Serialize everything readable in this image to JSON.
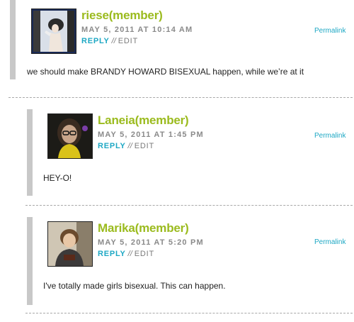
{
  "comments": [
    {
      "author": "riese(member)",
      "date": "MAY 5, 2011 AT 10:14 AM",
      "reply": "REPLY",
      "separator": "//",
      "edit": "EDIT",
      "permalink": "Permalink",
      "text": "we should make BRANDY HOWARD BISEXUAL happen, while we’re at it"
    },
    {
      "author": "Laneia(member)",
      "date": "MAY 5, 2011 AT 1:45 PM",
      "reply": "REPLY",
      "separator": "//",
      "edit": "EDIT",
      "permalink": "Permalink",
      "text": "HEY-O!"
    },
    {
      "author": "Marika(member)",
      "date": "MAY 5, 2011 AT 5:20 PM",
      "reply": "REPLY",
      "separator": "//",
      "edit": "EDIT",
      "permalink": "Permalink",
      "text": "I've totally made girls bisexual. This can happen."
    }
  ]
}
